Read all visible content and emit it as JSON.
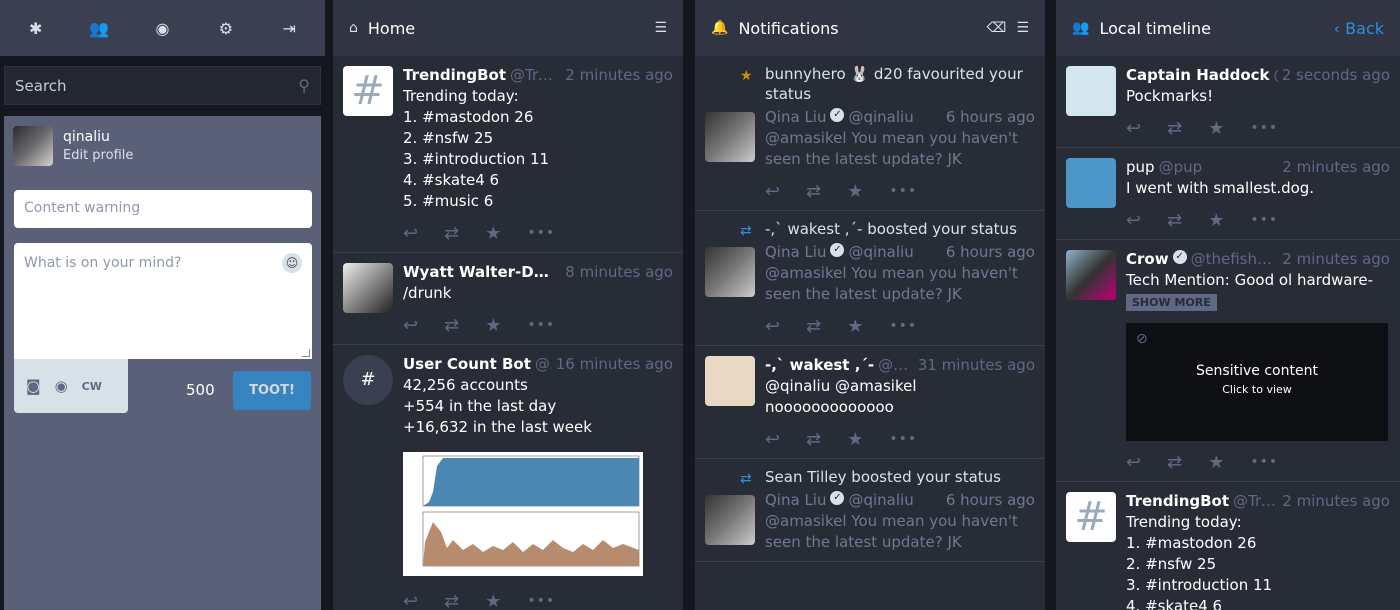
{
  "drawer": {
    "nav": [
      "asterisk-icon",
      "users-icon",
      "globe-icon",
      "gear-icon",
      "sign-out-icon"
    ],
    "search_placeholder": "Search",
    "account_name": "qinaliu",
    "edit_profile": "Edit profile",
    "cw_placeholder": "Content warning",
    "text_placeholder": "What is on your mind?",
    "cw_button": "CW",
    "char_count": "500",
    "toot_label": "TOOT!"
  },
  "home": {
    "title": "Home",
    "statuses": [
      {
        "name": "TrendingBot",
        "handle": "@TrendingBot",
        "time": "2 minutes ago",
        "body": "Trending today:\n1. #mastodon 26\n2. #nsfw 25\n3. #introduction 11\n4. #skate4 6\n5. #music 6"
      },
      {
        "name": "Wyatt Walter-Dawahare",
        "handle": "",
        "time": "8 minutes ago",
        "body": "/drunk"
      },
      {
        "name": "User Count Bot",
        "handle": "@usercount",
        "time": "16 minutes ago",
        "body": "42,256 accounts\n+554 in the last day\n+16,632 in the last week"
      }
    ]
  },
  "notifications": {
    "title": "Notifications",
    "items": [
      {
        "line": "bunnyhero 🐰 d20 favourited your status",
        "name": "Qina Liu",
        "handle": "@qinaliu",
        "time": "6 hours ago",
        "body": "@amasikel You mean you haven't seen the latest update? JK"
      },
      {
        "line": "-,` wakest ,´- boosted your status",
        "name": "Qina Liu",
        "handle": "@qinaliu",
        "time": "6 hours ago",
        "body": "@amasikel You mean you haven't seen the latest update? JK"
      },
      {
        "name": "-,` wakest ,´-",
        "handle": "@wakest",
        "time": "31 minutes ago",
        "body": "@qinaliu @amasikel\nnooooooooooooo"
      },
      {
        "line": "Sean Tilley boosted your status",
        "name": "Qina Liu",
        "handle": "@qinaliu",
        "time": "6 hours ago",
        "body": "@amasikel You mean you haven't seen the latest update? JK"
      }
    ]
  },
  "local": {
    "title": "Local timeline",
    "back": "Back",
    "statuses": [
      {
        "name": "Captain Haddock",
        "handle": "@Haddock",
        "time": "2 seconds ago",
        "body": "Pockmarks!"
      },
      {
        "name": "pup",
        "handle": "@pup",
        "time": "2 minutes ago",
        "body": "I went with smallest.dog."
      },
      {
        "name": "Crow",
        "handle": "@thefishcrow",
        "time": "2 minutes ago",
        "body": "Tech Mention: Good ol hardware-",
        "show_more": "SHOW MORE",
        "sensitive_title": "Sensitive content",
        "sensitive_sub": "Click to view"
      },
      {
        "name": "TrendingBot",
        "handle": "@TrendingBot",
        "time": "2 minutes ago",
        "body": "Trending today:\n1. #mastodon 26\n2. #nsfw 25\n3. #introduction 11\n4. #skate4 6"
      }
    ]
  },
  "colors": {
    "accent": "#2b90d9",
    "bg": "#282c37",
    "muted": "#606984"
  }
}
